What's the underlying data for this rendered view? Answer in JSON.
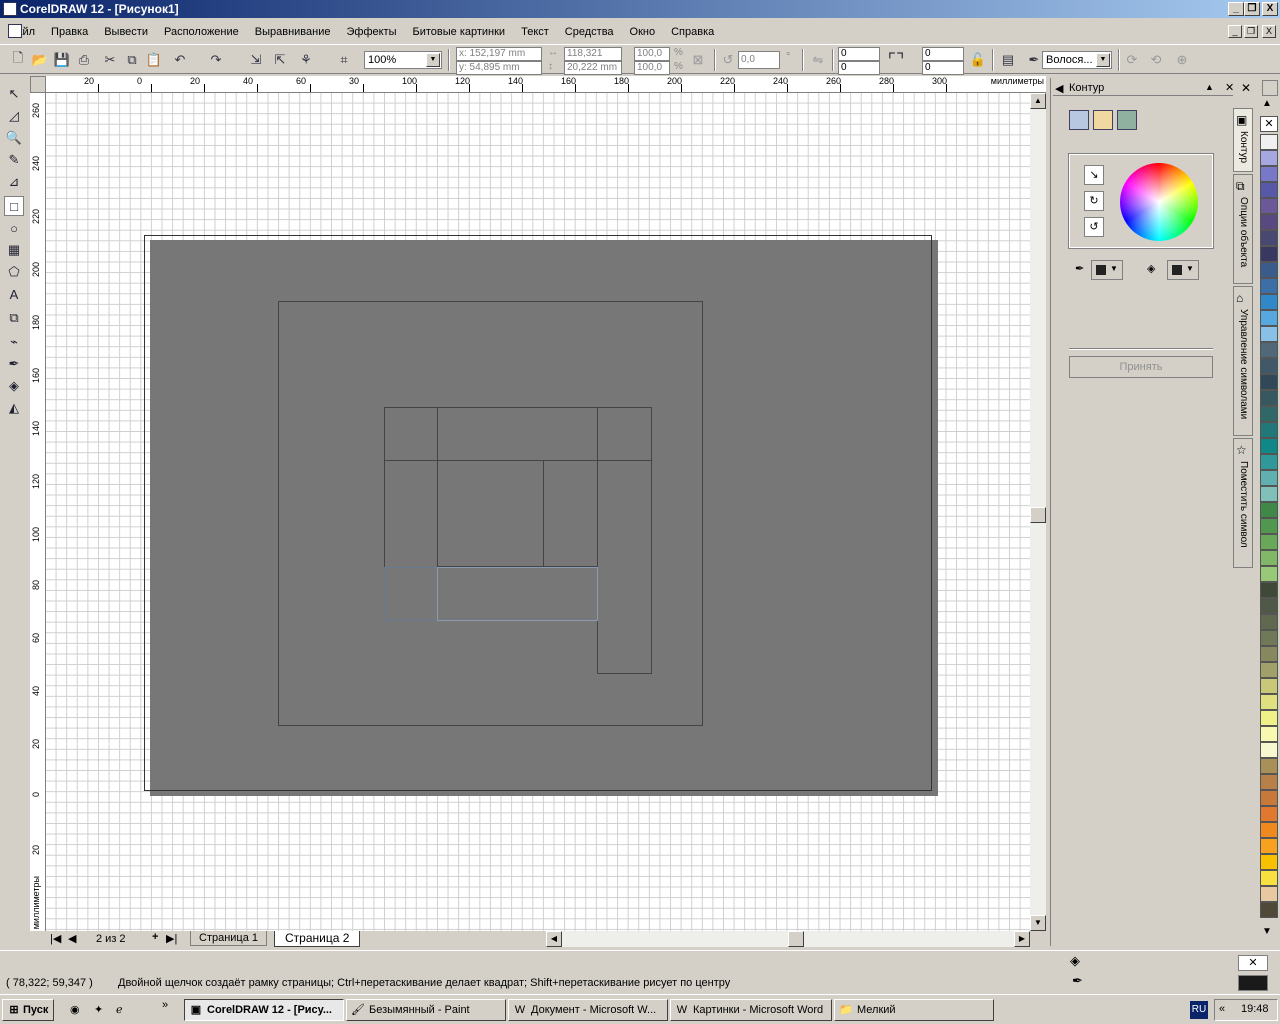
{
  "window": {
    "title": "CorelDRAW 12 - [Рисунок1]",
    "min": "_",
    "restore": "❐",
    "close": "X"
  },
  "menu": [
    "Файл",
    "Правка",
    "Вывести",
    "Расположение",
    "Выравнивание",
    "Эффекты",
    "Битовые картинки",
    "Текст",
    "Средства",
    "Окно",
    "Справка"
  ],
  "toolbar": {
    "zoom": "100%",
    "x": "x: 152,197 mm",
    "y": "y: 54,895 mm",
    "w": "118,321 mm",
    "h": "20,222 mm",
    "sx": "100,0",
    "sy": "100,0",
    "pct1": "%",
    "pct2": "%",
    "angle": "0,0",
    "deg": "°",
    "corner1": "0",
    "corner2": "0",
    "corner3": "0",
    "corner4": "0",
    "outline": "Волося..."
  },
  "ruler": {
    "top_ticks": [
      "20",
      "0",
      "20",
      "40",
      "60",
      "30",
      "100",
      "120",
      "140",
      "160",
      "180",
      "200",
      "220",
      "240",
      "260",
      "280",
      "300"
    ],
    "unit_h": "миллиметры",
    "left_ticks": [
      "260",
      "240",
      "220",
      "200",
      "180",
      "160",
      "140",
      "120",
      "100",
      "80",
      "60",
      "40",
      "20",
      "0",
      "20"
    ],
    "unit_v": "миллиметры"
  },
  "pagetabs": {
    "counter": "2 из 2",
    "tab1": "Страница 1",
    "tab2": "Страница 2"
  },
  "docker": {
    "title": "Контур",
    "apply": "Принять",
    "tabs": [
      "Контур",
      "Опции объекта",
      "Управление символами",
      "Поместить символ"
    ]
  },
  "palette_colors": [
    "#f0f0f0",
    "#a6a6e0",
    "#7878c8",
    "#5858a8",
    "#6a5898",
    "#584a80",
    "#484870",
    "#383860",
    "#3a5c8c",
    "#3c6ea8",
    "#3088c8",
    "#58a8e0",
    "#88c0e8",
    "#506878",
    "#405868",
    "#304858",
    "#385860",
    "#306868",
    "#207878",
    "#108888",
    "#309898",
    "#60b0b0",
    "#80c0b8",
    "#408848",
    "#509850",
    "#68a858",
    "#80b868",
    "#98c878",
    "#404838",
    "#505848",
    "#606850",
    "#707858",
    "#888860",
    "#a0a068",
    "#c8c878",
    "#e0e080",
    "#f0f088",
    "#f8f8b0",
    "#f8f8d0",
    "#a89058",
    "#b88048",
    "#c87838",
    "#e07830",
    "#f08820",
    "#f8a020",
    "#f8c000",
    "#f8e040",
    "#e8c8a0",
    "#504838"
  ],
  "status": {
    "coords": "( 78,322; 59,347 )",
    "hint": "Двойной щелчок создаёт рамку страницы; Ctrl+перетаскивание делает квадрат; Shift+перетаскивание рисует по центру"
  },
  "taskbar": {
    "start": "Пуск",
    "more": "»",
    "tasks": [
      "CorelDRAW 12 - [Рису...",
      "Безымянный - Paint",
      "Документ - Microsoft W...",
      "Картинки - Microsoft Word",
      "Мелкий"
    ],
    "lang": "RU",
    "clock_prefix": "«",
    "time": "19:48"
  }
}
